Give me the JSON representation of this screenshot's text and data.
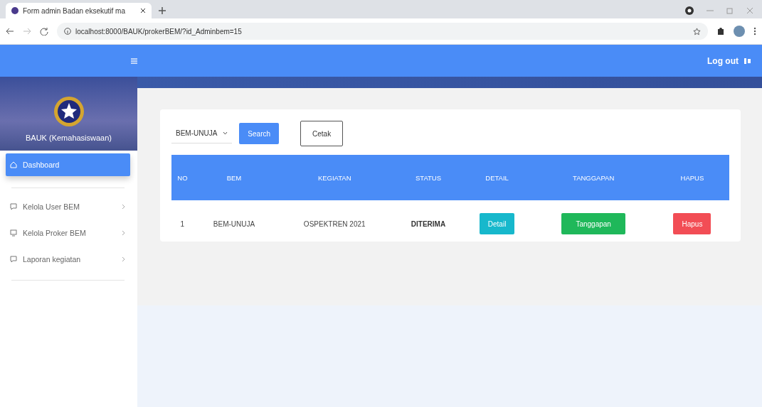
{
  "browser": {
    "tab_title": "Form admin Badan eksekutif ma",
    "url": "localhost:8000/BAUK/prokerBEM/?id_Adminbem=15"
  },
  "topbar": {
    "logout": "Log out"
  },
  "sidebar": {
    "title": "BAUK (Kemahasiswaan)",
    "items": [
      {
        "label": "Dashboard",
        "selected": true,
        "expandable": false
      },
      {
        "label": "Kelola User BEM",
        "selected": false,
        "expandable": true
      },
      {
        "label": "Kelola Proker BEM",
        "selected": false,
        "expandable": true
      },
      {
        "label": "Laporan kegiatan",
        "selected": false,
        "expandable": true
      }
    ]
  },
  "filter": {
    "value": "BEM-UNUJA",
    "search": "Search",
    "print": "Cetak"
  },
  "table": {
    "columns": [
      "NO",
      "BEM",
      "KEGIATAN",
      "STATUS",
      "DETAIL",
      "TANGGAPAN",
      "HAPUS"
    ],
    "rows": [
      {
        "no": "1",
        "bem": "BEM-UNUJA",
        "kegiatan": "OSPEKTREN 2021",
        "status": "DITERIMA",
        "detail": "Detail",
        "tanggapan": "Tanggapan",
        "hapus": "Hapus"
      }
    ]
  }
}
